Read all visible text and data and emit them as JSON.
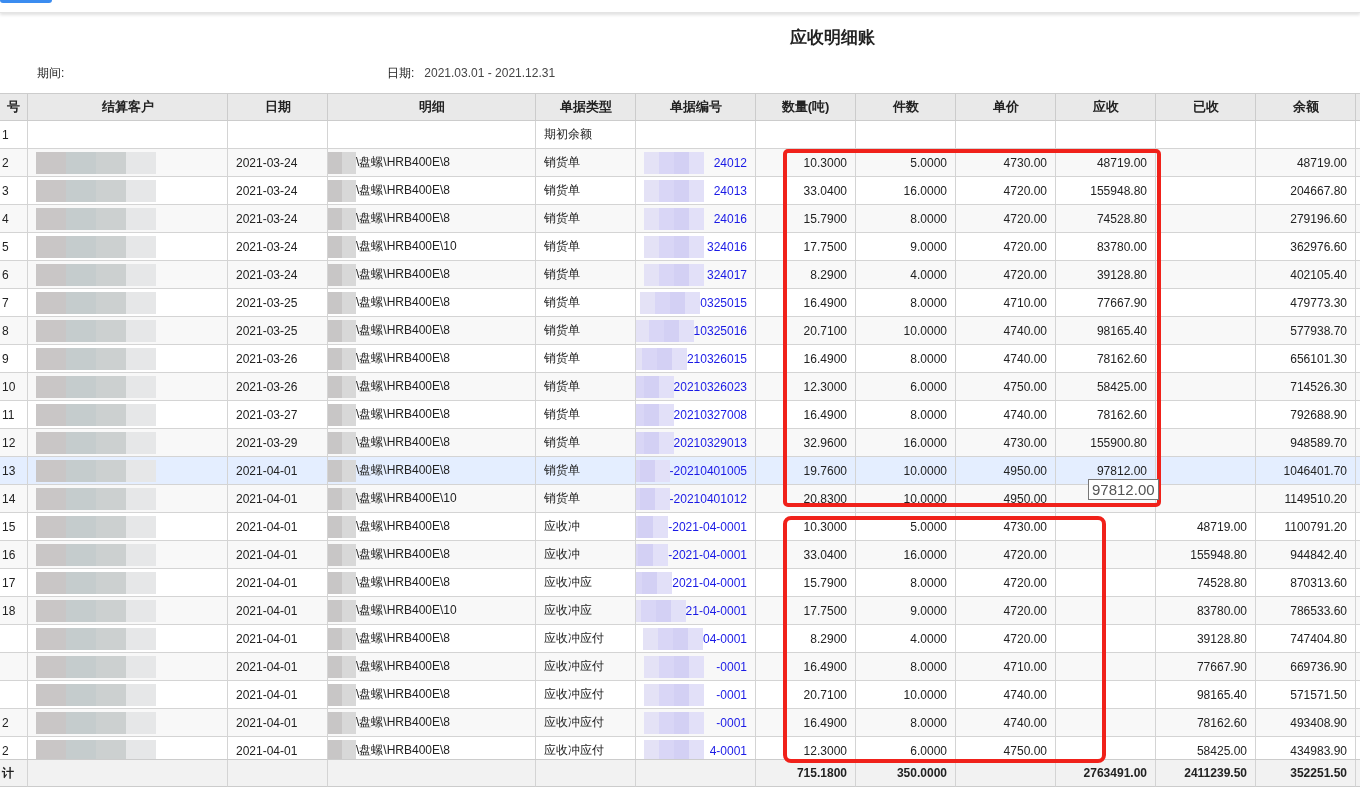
{
  "title": "应收明细账",
  "period": {
    "label": "期间:"
  },
  "date_range": {
    "label": "日期:",
    "value": "2021.03.01 - 2021.12.31"
  },
  "table": {
    "columns": [
      "号",
      "结算客户",
      "日期",
      "明细",
      "单据类型",
      "单据编号",
      "数量(吨)",
      "件数",
      "单价",
      "应收",
      "已收",
      "余额"
    ],
    "rows": [
      {
        "no": "1",
        "doc_type": "期初余额",
        "hovered": false
      },
      {
        "no": "2",
        "date": "2021-03-24",
        "detail": "\\盘螺\\HRB400E\\8",
        "doc_type": "销货单",
        "doc_no": "24012",
        "qty": "10.3000",
        "pieces": "5.0000",
        "unit_price": "4730.00",
        "receivable": "48719.00",
        "balance": "48719.00",
        "hovered": false
      },
      {
        "no": "3",
        "date": "2021-03-24",
        "detail": "\\盘螺\\HRB400E\\8",
        "doc_type": "销货单",
        "doc_no": "24013",
        "qty": "33.0400",
        "pieces": "16.0000",
        "unit_price": "4720.00",
        "receivable": "155948.80",
        "balance": "204667.80",
        "hovered": false
      },
      {
        "no": "4",
        "date": "2021-03-24",
        "detail": "\\盘螺\\HRB400E\\8",
        "doc_type": "销货单",
        "doc_no": "24016",
        "qty": "15.7900",
        "pieces": "8.0000",
        "unit_price": "4720.00",
        "receivable": "74528.80",
        "balance": "279196.60",
        "hovered": false
      },
      {
        "no": "5",
        "date": "2021-03-24",
        "detail": "\\盘螺\\HRB400E\\10",
        "doc_type": "销货单",
        "doc_no": "324016",
        "qty": "17.7500",
        "pieces": "9.0000",
        "unit_price": "4720.00",
        "receivable": "83780.00",
        "balance": "362976.60",
        "hovered": false
      },
      {
        "no": "6",
        "date": "2021-03-24",
        "detail": "\\盘螺\\HRB400E\\8",
        "doc_type": "销货单",
        "doc_no": "324017",
        "qty": "8.2900",
        "pieces": "4.0000",
        "unit_price": "4720.00",
        "receivable": "39128.80",
        "balance": "402105.40",
        "hovered": false
      },
      {
        "no": "7",
        "date": "2021-03-25",
        "detail": "\\盘螺\\HRB400E\\8",
        "doc_type": "销货单",
        "doc_no": "0325015",
        "qty": "16.4900",
        "pieces": "8.0000",
        "unit_price": "4710.00",
        "receivable": "77667.90",
        "balance": "479773.30",
        "hovered": false
      },
      {
        "no": "8",
        "date": "2021-03-25",
        "detail": "\\盘螺\\HRB400E\\8",
        "doc_type": "销货单",
        "doc_no": "10325016",
        "qty": "20.7100",
        "pieces": "10.0000",
        "unit_price": "4740.00",
        "receivable": "98165.40",
        "balance": "577938.70",
        "hovered": false
      },
      {
        "no": "9",
        "date": "2021-03-26",
        "detail": "\\盘螺\\HRB400E\\8",
        "doc_type": "销货单",
        "doc_no": "210326015",
        "qty": "16.4900",
        "pieces": "8.0000",
        "unit_price": "4740.00",
        "receivable": "78162.60",
        "balance": "656101.30",
        "hovered": false
      },
      {
        "no": "10",
        "date": "2021-03-26",
        "detail": "\\盘螺\\HRB400E\\8",
        "doc_type": "销货单",
        "doc_no": "20210326023",
        "qty": "12.3000",
        "pieces": "6.0000",
        "unit_price": "4750.00",
        "receivable": "58425.00",
        "balance": "714526.30",
        "hovered": false
      },
      {
        "no": "11",
        "date": "2021-03-27",
        "detail": "\\盘螺\\HRB400E\\8",
        "doc_type": "销货单",
        "doc_no": "20210327008",
        "qty": "16.4900",
        "pieces": "8.0000",
        "unit_price": "4740.00",
        "receivable": "78162.60",
        "balance": "792688.90",
        "hovered": false
      },
      {
        "no": "12",
        "date": "2021-03-29",
        "detail": "\\盘螺\\HRB400E\\8",
        "doc_type": "销货单",
        "doc_no": "20210329013",
        "qty": "32.9600",
        "pieces": "16.0000",
        "unit_price": "4730.00",
        "receivable": "155900.80",
        "balance": "948589.70",
        "hovered": false
      },
      {
        "no": "13",
        "date": "2021-04-01",
        "detail": "\\盘螺\\HRB400E\\8",
        "doc_type": "销货单",
        "doc_no": "-20210401005",
        "qty": "19.7600",
        "pieces": "10.0000",
        "unit_price": "4950.00",
        "receivable": "97812.00",
        "balance": "1046401.70",
        "hovered": true
      },
      {
        "no": "14",
        "date": "2021-04-01",
        "detail": "\\盘螺\\HRB400E\\10",
        "doc_type": "销货单",
        "doc_no": "-20210401012",
        "qty": "20.8300",
        "pieces": "10.0000",
        "unit_price": "4950.00",
        "balance": "1149510.20",
        "hovered": false
      },
      {
        "no": "15",
        "date": "2021-04-01",
        "detail": "\\盘螺\\HRB400E\\8",
        "doc_type": "应收冲",
        "doc_no": "-2021-04-0001",
        "qty": "10.3000",
        "pieces": "5.0000",
        "unit_price": "4730.00",
        "received": "48719.00",
        "balance": "1100791.20",
        "hovered": false
      },
      {
        "no": "16",
        "date": "2021-04-01",
        "detail": "\\盘螺\\HRB400E\\8",
        "doc_type": "应收冲",
        "doc_no": "-2021-04-0001",
        "qty": "33.0400",
        "pieces": "16.0000",
        "unit_price": "4720.00",
        "received": "155948.80",
        "balance": "944842.40",
        "hovered": false
      },
      {
        "no": "17",
        "date": "2021-04-01",
        "detail": "\\盘螺\\HRB400E\\8",
        "doc_type": "应收冲应",
        "doc_no": "2021-04-0001",
        "qty": "15.7900",
        "pieces": "8.0000",
        "unit_price": "4720.00",
        "received": "74528.80",
        "balance": "870313.60",
        "hovered": false
      },
      {
        "no": "18",
        "date": "2021-04-01",
        "detail": "\\盘螺\\HRB400E\\10",
        "doc_type": "应收冲应",
        "doc_no": "21-04-0001",
        "qty": "17.7500",
        "pieces": "9.0000",
        "unit_price": "4720.00",
        "received": "83780.00",
        "balance": "786533.60",
        "hovered": false
      },
      {
        "date": "2021-04-01",
        "detail": "\\盘螺\\HRB400E\\8",
        "doc_type": "应收冲应付",
        "doc_no": "04-0001",
        "qty": "8.2900",
        "pieces": "4.0000",
        "unit_price": "4720.00",
        "received": "39128.80",
        "balance": "747404.80",
        "hovered": false
      },
      {
        "date": "2021-04-01",
        "detail": "\\盘螺\\HRB400E\\8",
        "doc_type": "应收冲应付",
        "doc_no": "-0001",
        "qty": "16.4900",
        "pieces": "8.0000",
        "unit_price": "4710.00",
        "received": "77667.90",
        "balance": "669736.90",
        "hovered": false
      },
      {
        "date": "2021-04-01",
        "detail": "\\盘螺\\HRB400E\\8",
        "doc_type": "应收冲应付",
        "doc_no": "-0001",
        "qty": "20.7100",
        "pieces": "10.0000",
        "unit_price": "4740.00",
        "received": "98165.40",
        "balance": "571571.50",
        "hovered": false
      },
      {
        "no": "2",
        "date": "2021-04-01",
        "detail": "\\盘螺\\HRB400E\\8",
        "doc_type": "应收冲应付",
        "doc_no": "-0001",
        "qty": "16.4900",
        "pieces": "8.0000",
        "unit_price": "4740.00",
        "received": "78162.60",
        "balance": "493408.90",
        "hovered": false
      },
      {
        "no": "2",
        "date": "2021-04-01",
        "detail": "\\盘螺\\HRB400E\\8",
        "doc_type": "应收冲应付",
        "doc_no": "4-0001",
        "qty": "12.3000",
        "pieces": "6.0000",
        "unit_price": "4750.00",
        "received": "58425.00",
        "balance": "434983.90",
        "hovered": false
      }
    ],
    "total": {
      "no": "计",
      "qty": "715.1800",
      "pieces": "350.0000",
      "receivable": "2763491.00",
      "received": "2411239.50",
      "balance": "352251.50"
    }
  },
  "tooltip": {
    "text": "97812.00"
  },
  "annotations": [
    {
      "kind": "frame"
    },
    {
      "kind": "frame"
    }
  ]
}
